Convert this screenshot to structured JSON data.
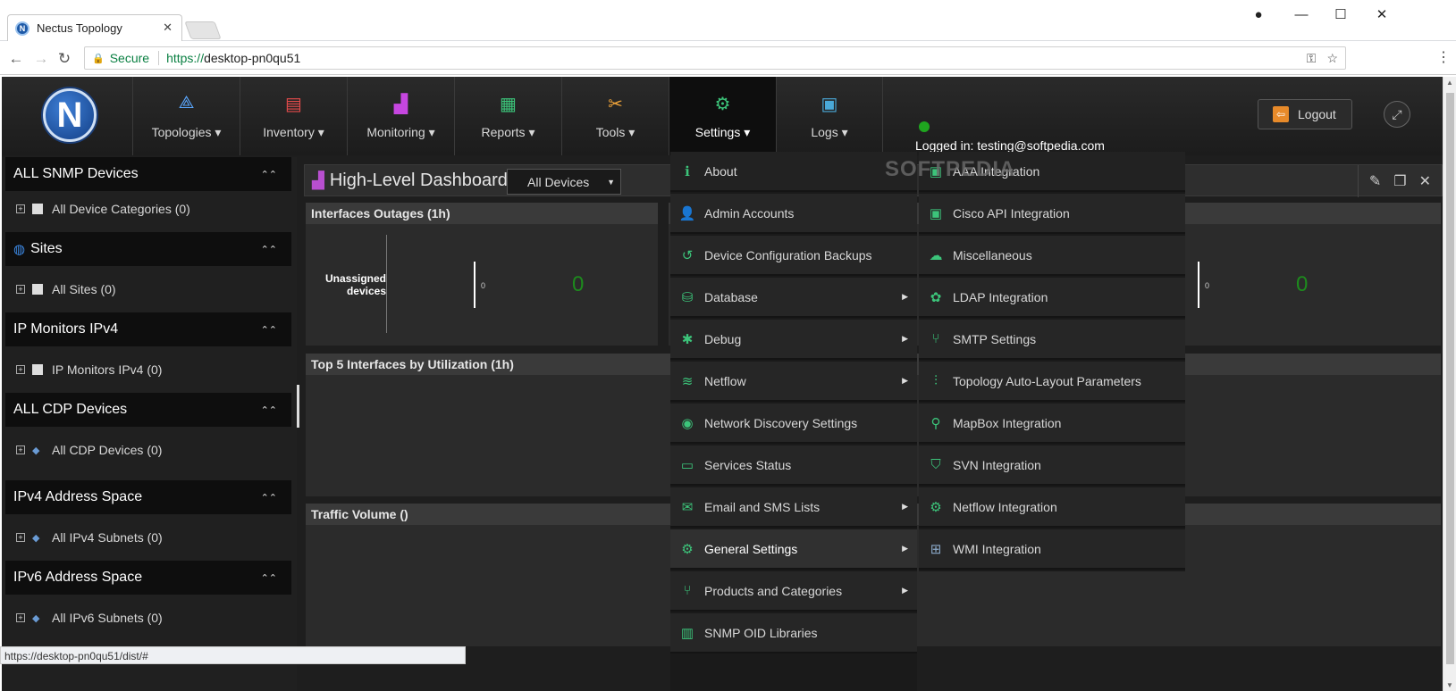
{
  "browser": {
    "tab_title": "Nectus Topology",
    "secure_label": "Secure",
    "url_scheme": "https://",
    "url_host": "desktop-pn0qu51",
    "status_url": "https://desktop-pn0qu51/dist/#"
  },
  "nav": {
    "items": [
      {
        "label": "Topologies ▾",
        "icon": "topology-icon"
      },
      {
        "label": "Inventory ▾",
        "icon": "inventory-icon"
      },
      {
        "label": "Monitoring ▾",
        "icon": "monitoring-icon"
      },
      {
        "label": "Reports ▾",
        "icon": "reports-icon"
      },
      {
        "label": "Tools ▾",
        "icon": "tools-icon"
      },
      {
        "label": "Settings ▾",
        "icon": "gear-icon"
      },
      {
        "label": "Logs ▾",
        "icon": "logs-icon"
      }
    ],
    "active": "Settings",
    "logged_in": "Logged in: testing@softpedia.com",
    "logout": "Logout",
    "status_color": "#1fa51f"
  },
  "sidebar": {
    "sections": [
      {
        "title": "ALL SNMP Devices",
        "item": "All Device Categories (0)"
      },
      {
        "title": "Sites",
        "item": "All Sites (0)"
      },
      {
        "title": "IP Monitors IPv4",
        "item": "IP Monitors IPv4 (0)"
      },
      {
        "title": "ALL CDP Devices",
        "item": "All CDP Devices (0)"
      },
      {
        "title": "IPv4 Address Space",
        "item": "All IPv4 Subnets (0)"
      },
      {
        "title": "IPv6 Address Space",
        "item": "All IPv6 Subnets (0)"
      }
    ]
  },
  "dashboard": {
    "title": "High-Level Dashboard",
    "filter": "All Devices",
    "panels": {
      "outages": "Interfaces Outages (1h)",
      "unassigned": "Unassigned devices",
      "axis_zero": "0",
      "count": "0",
      "top5": "Top 5 Interfaces by Utilization (1h)",
      "traffic": "Traffic Volume ()"
    }
  },
  "settings_menu": [
    {
      "label": "About",
      "icon": "info-icon",
      "sub": false
    },
    {
      "label": "Admin Accounts",
      "icon": "user-icon",
      "sub": false
    },
    {
      "label": "Device Configuration Backups",
      "icon": "history-icon",
      "sub": false
    },
    {
      "label": "Database",
      "icon": "database-icon",
      "sub": true
    },
    {
      "label": "Debug",
      "icon": "bug-icon",
      "sub": true
    },
    {
      "label": "Netflow",
      "icon": "waves-icon",
      "sub": true
    },
    {
      "label": "Network Discovery Settings",
      "icon": "eye-icon",
      "sub": false
    },
    {
      "label": "Services Status",
      "icon": "pulse-icon",
      "sub": false
    },
    {
      "label": "Email and SMS Lists",
      "icon": "envelope-icon",
      "sub": true
    },
    {
      "label": "General Settings",
      "icon": "gear-icon",
      "sub": true
    },
    {
      "label": "Products and Categories",
      "icon": "branch-icon",
      "sub": true
    },
    {
      "label": "SNMP OID Libraries",
      "icon": "book-icon",
      "sub": false
    }
  ],
  "general_submenu": [
    {
      "label": "AAA Integration",
      "icon": "chip-icon"
    },
    {
      "label": "Cisco API Integration",
      "icon": "chip-icon"
    },
    {
      "label": "Miscellaneous",
      "icon": "cloud-icon"
    },
    {
      "label": "LDAP Integration",
      "icon": "network-icon"
    },
    {
      "label": "SMTP Settings",
      "icon": "branch-icon"
    },
    {
      "label": "Topology Auto-Layout Parameters",
      "icon": "sliders-icon"
    },
    {
      "label": "MapBox Integration",
      "icon": "pin-icon"
    },
    {
      "label": "SVN Integration",
      "icon": "shield-icon"
    },
    {
      "label": "Netflow Integration",
      "icon": "gear-icon"
    },
    {
      "label": "WMI Integration",
      "icon": "windows-icon"
    }
  ],
  "watermark": "SOFTPEDIA"
}
